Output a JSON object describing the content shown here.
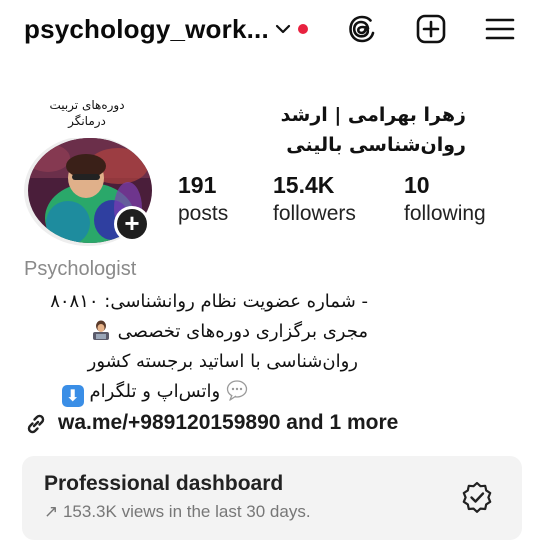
{
  "header": {
    "username": "psychology_work...",
    "icons": [
      "chevron-down-icon",
      "notification-dot",
      "threads-icon",
      "create-post-icon",
      "menu-icon"
    ]
  },
  "colors": {
    "accent_red": "#e8213f",
    "text": "#111111",
    "muted": "#8a8a8a",
    "dashboard_bg": "#f3f3f3"
  },
  "profile": {
    "note": "دوره‌های تربیت\nدرمانگر",
    "full_name": "زهرا بهرامی | ارشد روان‌شناسی بالینی",
    "stats": {
      "posts": {
        "value": "191",
        "label": "posts"
      },
      "followers": {
        "value": "15.4K",
        "label": "followers"
      },
      "following": {
        "value": "10",
        "label": "following"
      }
    },
    "category": "Psychologist",
    "bio": {
      "line1": "- شماره عضویت نظام روانشناسی: ۸۰۸۱۰",
      "line2": "مجری برگزاری دوره‌های تخصصی",
      "line3": "روان‌شناسی با اساتید برجسته کشور",
      "line4": "واتس‌اپ و تلگرام"
    },
    "link": "wa.me/+989120159890 and 1 more"
  },
  "dashboard": {
    "title": "Professional dashboard",
    "subtitle": "↗ 153.3K views in the last 30 days."
  }
}
